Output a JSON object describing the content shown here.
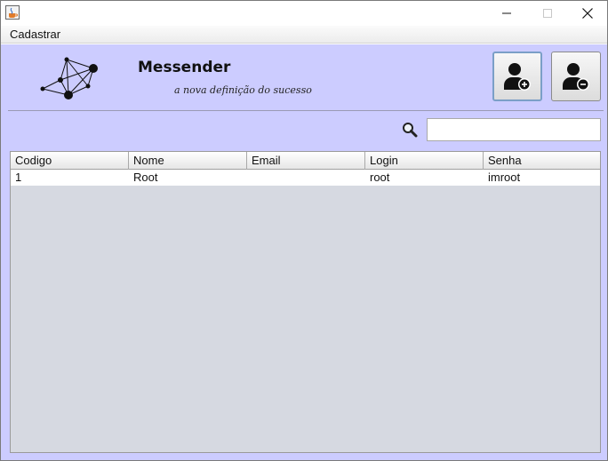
{
  "window": {
    "icon": "java-cup-icon",
    "controls": {
      "minimize": "minimize-icon",
      "maximize": "maximize-icon",
      "close": "close-icon"
    }
  },
  "menubar": {
    "items": [
      {
        "label": "Cadastrar"
      }
    ]
  },
  "header": {
    "title": "Messender",
    "subtitle": "a nova definição do sucesso",
    "logo_icon": "network-graph-icon"
  },
  "toolbar": {
    "add_user_icon": "add-user-icon",
    "remove_user_icon": "remove-user-icon"
  },
  "search": {
    "icon": "magnifier-icon",
    "value": "",
    "placeholder": ""
  },
  "table": {
    "columns": [
      "Codigo",
      "Nome",
      "Email",
      "Login",
      "Senha"
    ],
    "rows": [
      [
        "1",
        "Root",
        "",
        "root",
        "imroot"
      ]
    ]
  },
  "colors": {
    "content_bg": "#ccccff",
    "table_empty_bg": "#d6d9e1",
    "selected_button_border": "#7b9fc7"
  }
}
